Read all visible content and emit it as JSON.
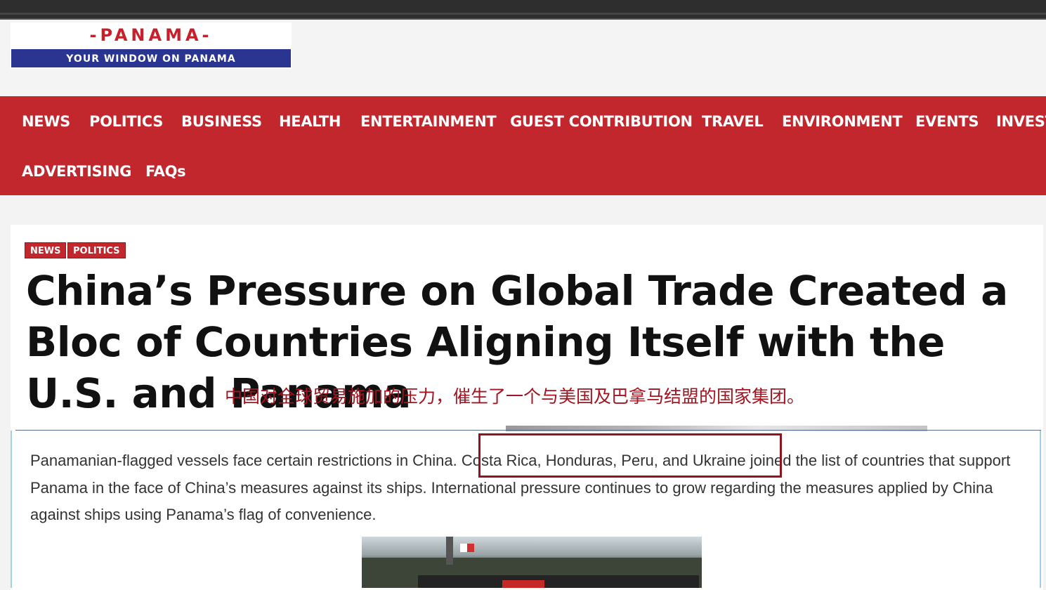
{
  "logo": {
    "title": "-PANAMA-",
    "tagline": "YOUR WINDOW ON PANAMA"
  },
  "nav": {
    "items": [
      "NEWS",
      "POLITICS",
      "BUSINESS",
      "HEALTH",
      "ENTERTAINMENT",
      "GUEST CONTRIBUTION",
      "TRAVEL",
      "ENVIRONMENT",
      "EVENTS",
      "INVEST",
      "ADVERTISING",
      "FAQs"
    ]
  },
  "article": {
    "tags": [
      "NEWS",
      "POLITICS"
    ],
    "headline": "China’s Pressure on Global Trade Created a Bloc of Countries Aligning Itself with the U.S. and Panama",
    "annotation_cn": "中国对全球贸易施加的压力，催生了一个与美国及巴拿马结盟的国家集团。",
    "body": "Panamanian-flagged vessels face certain restrictions in China. Costa Rica, Honduras, Peru, and Ukraine joined the list of countries that support Panama in the face of China’s measures against its ships.  International pressure continues to grow regarding the measures applied by China against ships using Panama’s flag of convenience."
  },
  "colors": {
    "nav_bg": "#c1272d",
    "logo_red": "#c8202b",
    "logo_blue": "#2a3592",
    "highlight_border": "#8e1420"
  }
}
